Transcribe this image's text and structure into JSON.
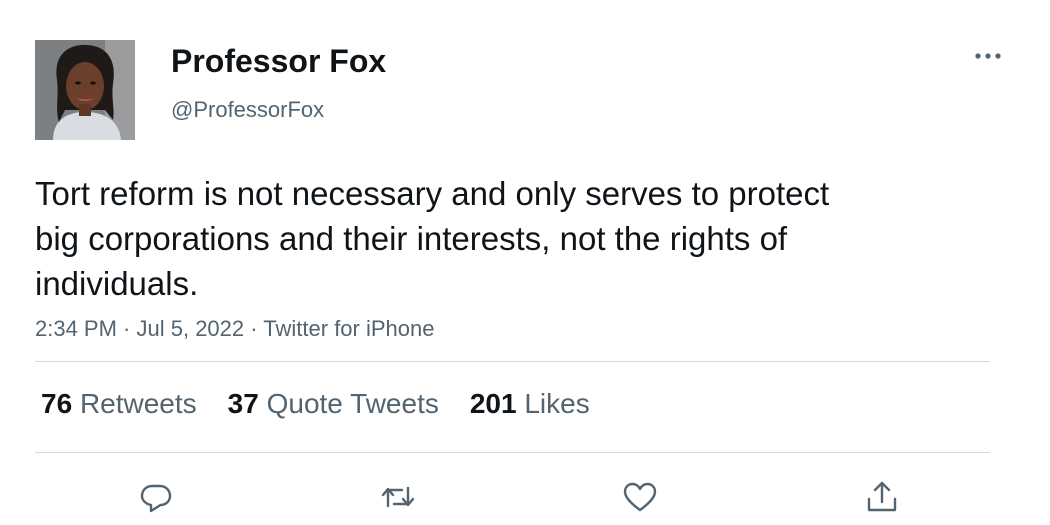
{
  "tweet": {
    "author": {
      "display_name": "Professor Fox",
      "handle": "@ProfessorFox"
    },
    "text": "Tort reform is not necessary and only serves to protect big corporations and their interests, not the rights of individuals.",
    "meta": {
      "time": "2:34 PM",
      "sep1": " · ",
      "date": "Jul 5, 2022",
      "sep2": " · ",
      "source": "Twitter for iPhone"
    },
    "stats": {
      "retweets_count": "76",
      "retweets_label": "Retweets",
      "quotes_count": "37",
      "quotes_label": "Quote Tweets",
      "likes_count": "201",
      "likes_label": "Likes"
    }
  },
  "icons": {
    "more": "more-horizontal-icon",
    "reply": "reply-icon",
    "retweet": "retweet-icon",
    "like": "heart-icon",
    "share": "share-icon"
  },
  "colors": {
    "text_primary": "#0f1419",
    "text_secondary": "#536471",
    "divider": "#cfd9de"
  }
}
